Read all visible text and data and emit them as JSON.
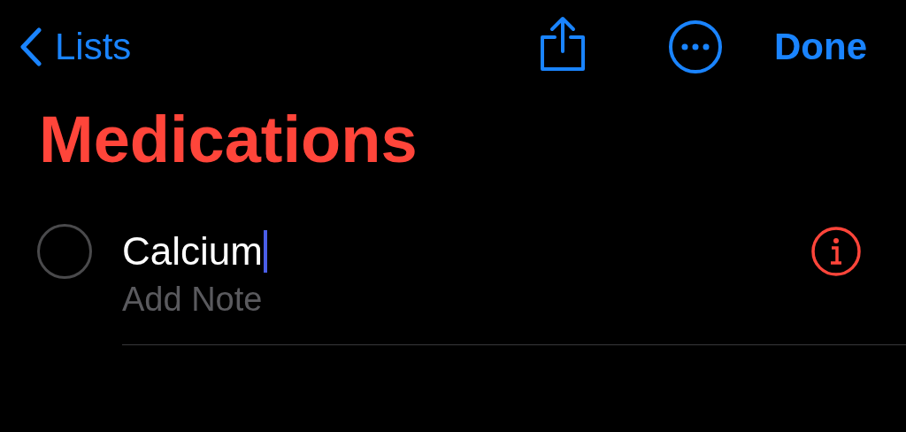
{
  "nav": {
    "back_label": "Lists",
    "done_label": "Done"
  },
  "title": "Medications",
  "reminders": [
    {
      "title": "Calcium",
      "note_placeholder": "Add Note",
      "completed": false,
      "editing": true
    }
  ]
}
